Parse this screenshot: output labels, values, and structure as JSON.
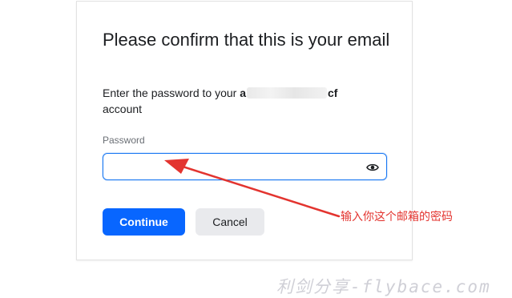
{
  "dialog": {
    "title": "Please confirm that this is your email",
    "description_prefix": "Enter the password to your",
    "email_start": "a",
    "email_end": "cf",
    "description_suffix": "account",
    "password_label": "Password",
    "password_value": "",
    "continue_label": "Continue",
    "cancel_label": "Cancel"
  },
  "annotation": {
    "text": "输入你这个邮箱的密码",
    "color": "#e3342f"
  },
  "watermark": {
    "text": "利剑分享-flybace.com"
  },
  "colors": {
    "primary": "#0866ff",
    "focus_border": "#1877f2",
    "secondary_bg": "#e9eaed"
  }
}
